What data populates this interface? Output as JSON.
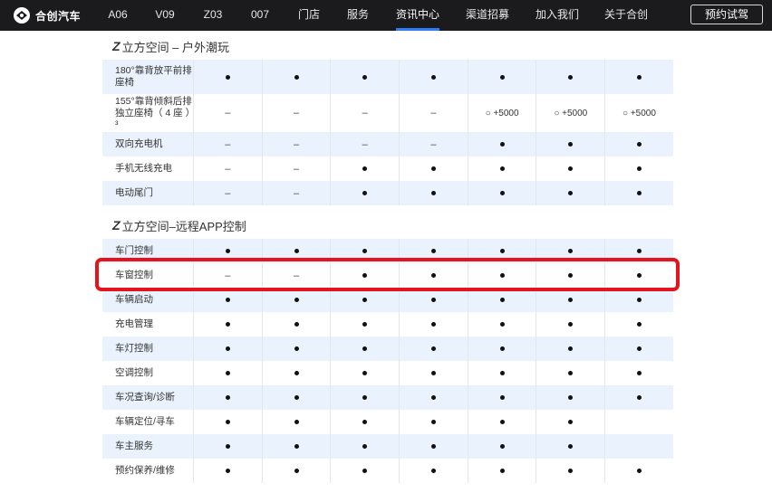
{
  "nav": {
    "brand": "合创汽车",
    "items": [
      {
        "label": "A06",
        "active": false
      },
      {
        "label": "V09",
        "active": false
      },
      {
        "label": "Z03",
        "active": false
      },
      {
        "label": "007",
        "active": false
      },
      {
        "label": "门店",
        "active": false
      },
      {
        "label": "服务",
        "active": false
      },
      {
        "label": "资讯中心",
        "active": true
      },
      {
        "label": "渠道招募",
        "active": false
      },
      {
        "label": "加入我们",
        "active": false
      },
      {
        "label": "关于合创",
        "active": false
      }
    ],
    "cta": "预约试驾"
  },
  "sections": [
    {
      "logo": "Z",
      "title": "立方空间 – 户外潮玩",
      "rows": [
        {
          "label": [
            "180°靠背放平前排",
            "座椅"
          ],
          "cells": [
            "●",
            "●",
            "●",
            "●",
            "●",
            "●",
            "●"
          ]
        },
        {
          "label": [
            "155°靠背倾斜后排",
            "独立座椅（ 4 座 ）³"
          ],
          "cells": [
            "–",
            "–",
            "–",
            "–",
            "○ +5000",
            "○ +5000",
            "○ +5000"
          ]
        },
        {
          "label": [
            "双向充电机"
          ],
          "cells": [
            "–",
            "–",
            "–",
            "–",
            "●",
            "●",
            "●"
          ]
        },
        {
          "label": [
            "手机无线充电"
          ],
          "cells": [
            "–",
            "–",
            "●",
            "●",
            "●",
            "●",
            "●"
          ]
        },
        {
          "label": [
            "电动尾门"
          ],
          "cells": [
            "–",
            "–",
            "●",
            "●",
            "●",
            "●",
            "●"
          ]
        }
      ]
    },
    {
      "logo": "Z",
      "title": "立方空间–远程APP控制",
      "rows": [
        {
          "label": [
            "车门控制"
          ],
          "cells": [
            "●",
            "●",
            "●",
            "●",
            "●",
            "●",
            "●"
          ]
        },
        {
          "label": [
            "车窗控制"
          ],
          "cells": [
            "–",
            "–",
            "●",
            "●",
            "●",
            "●",
            "●"
          ]
        },
        {
          "label": [
            "车辆启动"
          ],
          "cells": [
            "●",
            "●",
            "●",
            "●",
            "●",
            "●",
            "●"
          ]
        },
        {
          "label": [
            "充电管理"
          ],
          "cells": [
            "●",
            "●",
            "●",
            "●",
            "●",
            "●",
            "●"
          ]
        },
        {
          "label": [
            "车灯控制"
          ],
          "cells": [
            "●",
            "●",
            "●",
            "●",
            "●",
            "●",
            "●"
          ]
        },
        {
          "label": [
            "空调控制"
          ],
          "cells": [
            "●",
            "●",
            "●",
            "●",
            "●",
            "●",
            "●"
          ]
        },
        {
          "label": [
            "车况查询/诊断"
          ],
          "cells": [
            "●",
            "●",
            "●",
            "●",
            "●",
            "●",
            "●"
          ]
        },
        {
          "label": [
            "车辆定位/寻车"
          ],
          "cells": [
            "●",
            "●",
            "●",
            "●",
            "●",
            "●",
            ""
          ]
        },
        {
          "label": [
            "车主服务"
          ],
          "cells": [
            "●",
            "●",
            "●",
            "●",
            "●",
            "●",
            ""
          ]
        },
        {
          "label": [
            "预约保养/维修"
          ],
          "cells": [
            "●",
            "●",
            "●",
            "●",
            "●",
            "●",
            "●"
          ]
        }
      ]
    }
  ],
  "colors": {
    "nav_bg": "#1b1b1d",
    "row_blue": "#eaf3fd",
    "active_underline": "#2f7df2",
    "highlight_border": "#e3141b"
  }
}
